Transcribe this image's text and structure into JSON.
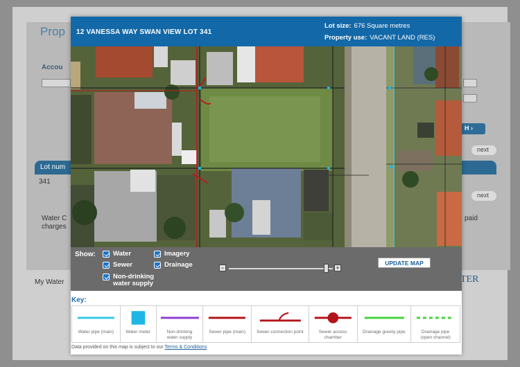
{
  "background": {
    "title": "Prop",
    "account_label": "Accou",
    "search_label": "H",
    "next_label": "next",
    "lot_header": "Lot num",
    "lot_value": "341",
    "water_line1": "Water C",
    "water_line2": "charges",
    "paid_text": "paid",
    "my_water": "My Water",
    "logo_text": "TER"
  },
  "modal": {
    "title": "12 VANESSA WAY SWAN VIEW LOT 341",
    "lot_size_label": "Lot size:",
    "lot_size_value": "676 Square metres",
    "property_use_label": "Property use:",
    "property_use_value": "VACANT LAND (RES)"
  },
  "controls": {
    "show_label": "Show:",
    "checkboxes": [
      {
        "label": "Water",
        "checked": true
      },
      {
        "label": "Sewer",
        "checked": true
      },
      {
        "label": "Non-drinking water supply",
        "checked": true
      },
      {
        "label": "Imagery",
        "checked": true
      },
      {
        "label": "Drainage",
        "checked": true
      }
    ],
    "nondrink_line1": "Non-drinking",
    "nondrink_line2": "water supply",
    "zoom_minus": "−",
    "zoom_plus": "+",
    "zoom_level": 0.93,
    "update_button": "UPDATE MAP"
  },
  "key": {
    "title": "Key:",
    "items": [
      {
        "label": "Water pipe (main)",
        "icon": "water-pipe-line",
        "color": "#35c8e8"
      },
      {
        "label": "Water meter",
        "icon": "water-meter-square",
        "color": "#1fb6e6"
      },
      {
        "label": "Non-drinking water supply",
        "icon": "nondrinking-line",
        "color": "#8e3fd0"
      },
      {
        "label": "Sewer pipe (main)",
        "icon": "sewer-pipe-line",
        "color": "#b3141a"
      },
      {
        "label": "Sewer connection point",
        "icon": "sewer-connection",
        "color": "#b3141a"
      },
      {
        "label": "Sewer access chamber",
        "icon": "sewer-chamber",
        "color": "#b3141a"
      },
      {
        "label": "Drainage gravity pipe",
        "icon": "drainage-gravity-line",
        "color": "#45d43f"
      },
      {
        "label": "Drainage pipe (open channel)",
        "icon": "drainage-open-dashed",
        "color": "#45d43f"
      }
    ]
  },
  "footer": {
    "text": "Data provided on this map is subject to our",
    "link": "Terms & Conditions"
  }
}
